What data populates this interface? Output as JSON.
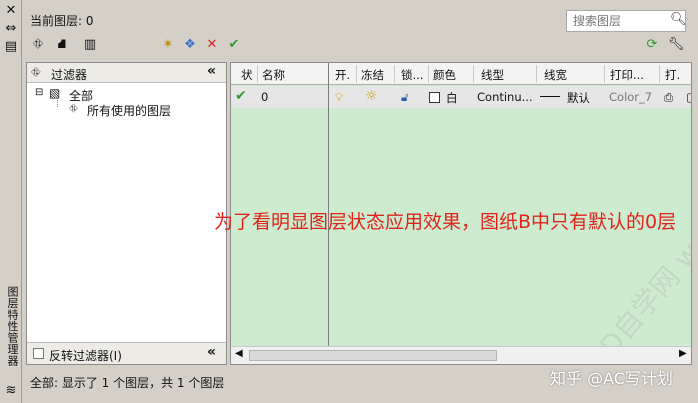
{
  "header": {
    "current_layer_label": "当前图层: 0",
    "search_placeholder": "搜索图层"
  },
  "sidebar": {
    "title": "图层特性管理器"
  },
  "filter_tree": {
    "title": "过滤器",
    "root": "全部",
    "child": "所有使用的图层",
    "invert_label": "反转过滤器(I)"
  },
  "layer_table": {
    "columns": [
      "状",
      "名称",
      "开.",
      "冻结",
      "锁...",
      "颜色",
      "线型",
      "线宽",
      "打印...",
      "打."
    ],
    "rows": [
      {
        "status": "✔",
        "name": "0",
        "color": "白",
        "linetype": "Continu...",
        "lineweight": "默认",
        "plot_style": "Color_7"
      }
    ]
  },
  "annotation": "为了看明显图层状态应用效果，图纸B中只有默认的0层",
  "status_text": "全部: 显示了 1 个图层，共 1 个图层",
  "watermark": "知乎 @AC写计划",
  "diag_watermark": "CAD自学网 www.caduw.com",
  "colors": {
    "list_bg": "#cdeccf",
    "accent_red": "#e0241b",
    "check_green": "#2e9a2e"
  }
}
